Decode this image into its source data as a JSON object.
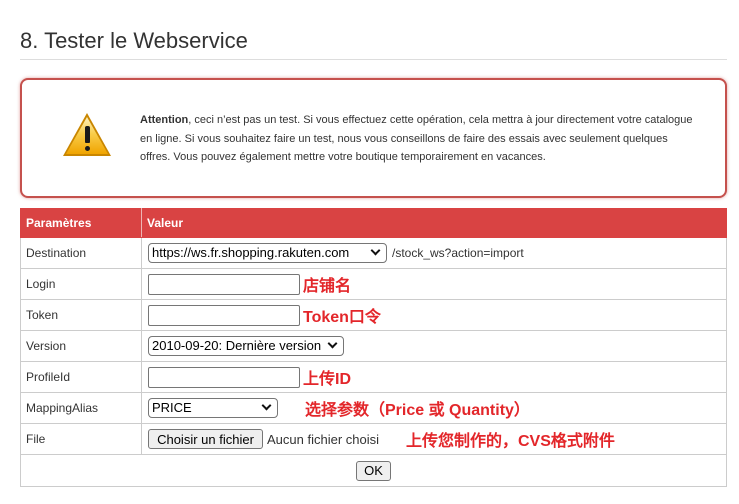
{
  "page": {
    "title": "8. Tester le Webservice"
  },
  "warning": {
    "icon": "warning-triangle-icon",
    "lead": "Attention",
    "text": ", ceci n’est pas un test. Si vous effectuez cette opération, cela mettra à jour directement votre catalogue en ligne. Si vous souhaitez faire un test, nous vous conseillons de faire des essais avec seulement quelques offres. Vous pouvez également mettre votre boutique temporairement en vacances."
  },
  "table": {
    "headers": {
      "param": "Paramètres",
      "value": "Valeur"
    },
    "rows": {
      "destination": {
        "label": "Destination",
        "selected": "https://ws.fr.shopping.rakuten.com",
        "suffix": "/stock_ws?action=import"
      },
      "login": {
        "label": "Login",
        "annotation": "店铺名"
      },
      "token": {
        "label": "Token",
        "annotation": "Token口令"
      },
      "version": {
        "label": "Version",
        "selected": "2010-09-20: Dernière version"
      },
      "profile_id": {
        "label": "ProfileId",
        "annotation": "上传ID"
      },
      "mapping_alias": {
        "label": "MappingAlias",
        "selected": "PRICE",
        "annotation": "选择参数（Price 或 Quantity）"
      },
      "file": {
        "label": "File",
        "button": "Choisir un fichier",
        "status": "Aucun fichier choisi",
        "annotation": "上传您制作的，CVS格式附件"
      }
    },
    "submit": "OK"
  },
  "colors": {
    "header_bg": "#d94343",
    "warning_border": "#c5514d",
    "annotation": "#e3262a"
  }
}
